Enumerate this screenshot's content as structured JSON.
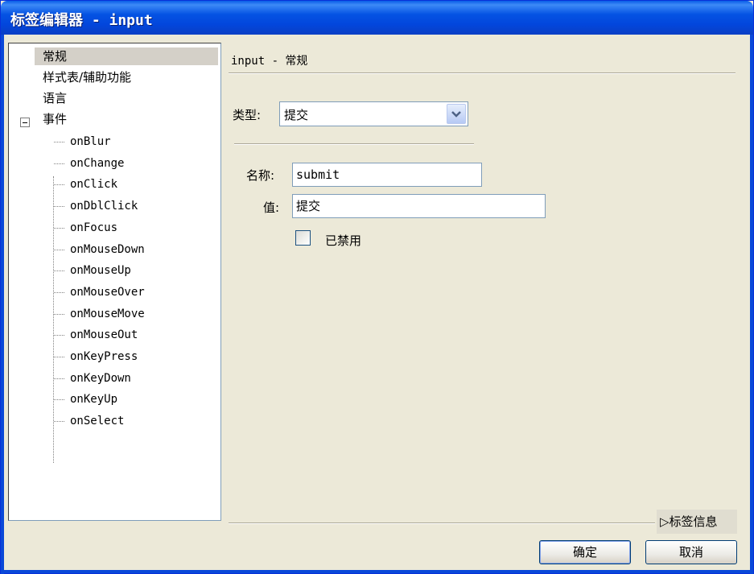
{
  "window": {
    "title": "标签编辑器 - input"
  },
  "tree": {
    "items": [
      {
        "label": "常规",
        "selected": true
      },
      {
        "label": "样式表/辅助功能"
      },
      {
        "label": "语言"
      },
      {
        "label": "事件"
      }
    ],
    "events": [
      "onBlur",
      "onChange",
      "onClick",
      "onDblClick",
      "onFocus",
      "onMouseDown",
      "onMouseUp",
      "onMouseOver",
      "onMouseMove",
      "onMouseOut",
      "onKeyPress",
      "onKeyDown",
      "onKeyUp",
      "onSelect"
    ]
  },
  "main": {
    "section_title": "input - 常规",
    "type_label": "类型:",
    "type_value": "提交",
    "name_label": "名称:",
    "name_value": "submit",
    "value_label": "值:",
    "value_value": "提交",
    "disabled_label": "已禁用",
    "disabled_checked": false
  },
  "footer": {
    "tag_info": "▷标签信息",
    "ok_label": "确定",
    "cancel_label": "取消"
  },
  "icons": {
    "dropdown": "chevron-down-icon",
    "expander": "minus-box-icon",
    "tag_info": "triangle-right-icon"
  }
}
